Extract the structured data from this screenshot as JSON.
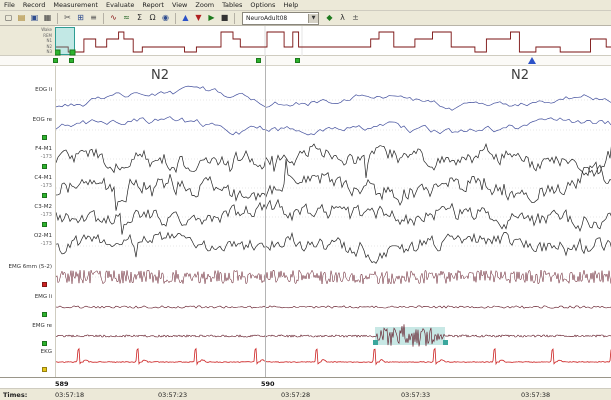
{
  "menu": {
    "items": [
      "File",
      "Record",
      "Measurement",
      "Evaluate",
      "Report",
      "View",
      "Zoom",
      "Tables",
      "Options",
      "Help"
    ]
  },
  "toolbar": {
    "montage_value": "NeuroAdult08",
    "items": [
      {
        "name": "new-record-icon",
        "glyph": "▢",
        "color": "#3f3f3f"
      },
      {
        "name": "open-record-icon",
        "glyph": "▤",
        "color": "#a07818"
      },
      {
        "name": "save-icon",
        "glyph": "▣",
        "color": "#2f4d8f"
      },
      {
        "name": "print-icon",
        "glyph": "▦",
        "color": "#3f3f3f"
      },
      {
        "type": "sep"
      },
      {
        "name": "cut-icon",
        "glyph": "✂",
        "color": "#555555"
      },
      {
        "name": "grid-icon",
        "glyph": "⊞",
        "color": "#2f4d8f"
      },
      {
        "name": "montage-icon",
        "glyph": "≡",
        "color": "#555555"
      },
      {
        "type": "sep"
      },
      {
        "name": "wave-icon",
        "glyph": "∿",
        "color": "#8a1a1a"
      },
      {
        "name": "filter-icon",
        "glyph": "≈",
        "color": "#2f6d2f"
      },
      {
        "name": "analysis-sigma-icon",
        "glyph": "Σ",
        "color": "#333333"
      },
      {
        "name": "impedance-omega-icon",
        "glyph": "Ω",
        "color": "#333333"
      },
      {
        "name": "target-icon",
        "glyph": "◉",
        "color": "#2f4d8f"
      },
      {
        "type": "sep"
      },
      {
        "name": "marker-up-icon",
        "glyph": "▲",
        "color": "#2c52c8"
      },
      {
        "name": "marker-down-icon",
        "glyph": "▼",
        "color": "#b02020"
      },
      {
        "name": "play-icon",
        "glyph": "▶",
        "color": "#1e7a1e"
      },
      {
        "name": "stop-icon",
        "glyph": "■",
        "color": "#333333"
      },
      {
        "type": "sep"
      },
      {
        "type": "combo",
        "name": "montage-select"
      },
      {
        "name": "event-icon",
        "glyph": "◆",
        "color": "#1e7a1e"
      },
      {
        "name": "lambda-icon",
        "glyph": "λ",
        "color": "#333333"
      },
      {
        "name": "calibrate-icon",
        "glyph": "±",
        "color": "#555555"
      }
    ]
  },
  "hypnogram": {
    "stage_axis": [
      "Wake",
      "REM",
      "N1",
      "N2",
      "N3"
    ]
  },
  "stages": {
    "left": "N2",
    "right": "N2"
  },
  "channels": [
    {
      "label": "EOG li",
      "color": "#44519e",
      "type": "eog",
      "amp": 6,
      "seed": 101,
      "indicator": null
    },
    {
      "label": "EOG re",
      "color": "#44519e",
      "type": "eog",
      "amp": 7,
      "seed": 202,
      "indicator": "#2db32d"
    },
    {
      "label": "F4-M1",
      "scale": "-173",
      "color": "#222222",
      "type": "eeg",
      "amp": 9,
      "seed": 303,
      "indicator": "#2db32d"
    },
    {
      "label": "C4-M1",
      "scale": "-173",
      "color": "#222222",
      "type": "eeg",
      "amp": 10,
      "seed": 404,
      "indicator": "#2db32d"
    },
    {
      "label": "C3-M2",
      "scale": "-173",
      "color": "#222222",
      "type": "eeg",
      "amp": 9,
      "seed": 505,
      "indicator": "#2db32d"
    },
    {
      "label": "O2-M1",
      "scale": "-173",
      "color": "#222222",
      "type": "eeg",
      "amp": 8,
      "seed": 606,
      "indicator": null
    },
    {
      "label": "EMG 6mm (5-2)",
      "color": "#5c0f1e",
      "type": "emg",
      "amp": 7,
      "seed": 707,
      "indicator": "#cc2222"
    },
    {
      "label": "EMG li",
      "color": "#5c0f1e",
      "type": "quiet",
      "amp": 1.2,
      "seed": 808,
      "indicator": "#2db32d"
    },
    {
      "label": "EMG re",
      "color": "#5c0f1e",
      "type": "burst",
      "amp": 1.1,
      "burst": [
        0.575,
        0.7
      ],
      "burst_amp": 12,
      "seed": 909,
      "indicator": "#2db32d"
    },
    {
      "label": "EKG",
      "color": "#cc2222",
      "type": "ecg",
      "amp": 1,
      "seed": 111,
      "indicator": "#e6c619"
    }
  ],
  "statusbar": {
    "times_label": "Times:",
    "epochs": [
      "589",
      "590"
    ],
    "times": [
      "03:57:18",
      "03:57:23",
      "03:57:28",
      "03:57:33",
      "03:57:38"
    ]
  },
  "colors": {
    "selection": "#3aa79d",
    "marker_green": "#2db32d",
    "marker_blue": "#2c52c8",
    "hypnogram_line": "#7a1010"
  }
}
